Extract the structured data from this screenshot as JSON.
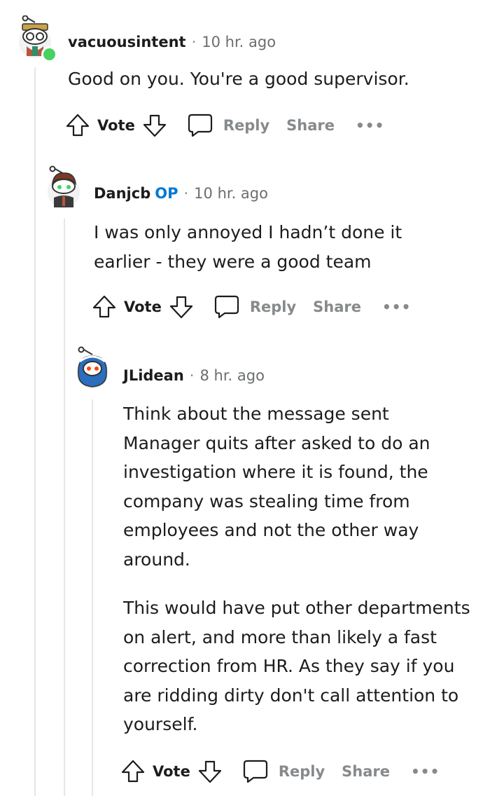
{
  "comments": [
    {
      "username": "vacuousintent",
      "separator": "·",
      "timestamp": "10 hr. ago",
      "paragraphs": [
        "Good on you. You're a good supervisor."
      ],
      "actions": {
        "vote": "Vote",
        "reply": "Reply",
        "share": "Share",
        "more": "•••"
      }
    },
    {
      "username": "Danjcb",
      "badge": "OP",
      "separator": "·",
      "timestamp": "10 hr. ago",
      "paragraphs": [
        "I was only annoyed I hadn’t done it earlier - they were a good team"
      ],
      "actions": {
        "vote": "Vote",
        "reply": "Reply",
        "share": "Share",
        "more": "•••"
      }
    },
    {
      "username": "JLidean",
      "separator": "·",
      "timestamp": "8 hr. ago",
      "paragraphs": [
        "Think about the message sent Manager quits after asked to do an investigation where it is found, the company was stealing time from employees and not the other way around.",
        "This would have put other departments on alert, and more than likely a fast correction from HR. As they say if you are ridding dirty don't call attention to yourself."
      ],
      "actions": {
        "vote": "Vote",
        "reply": "Reply",
        "share": "Share",
        "more": "•••"
      }
    }
  ]
}
